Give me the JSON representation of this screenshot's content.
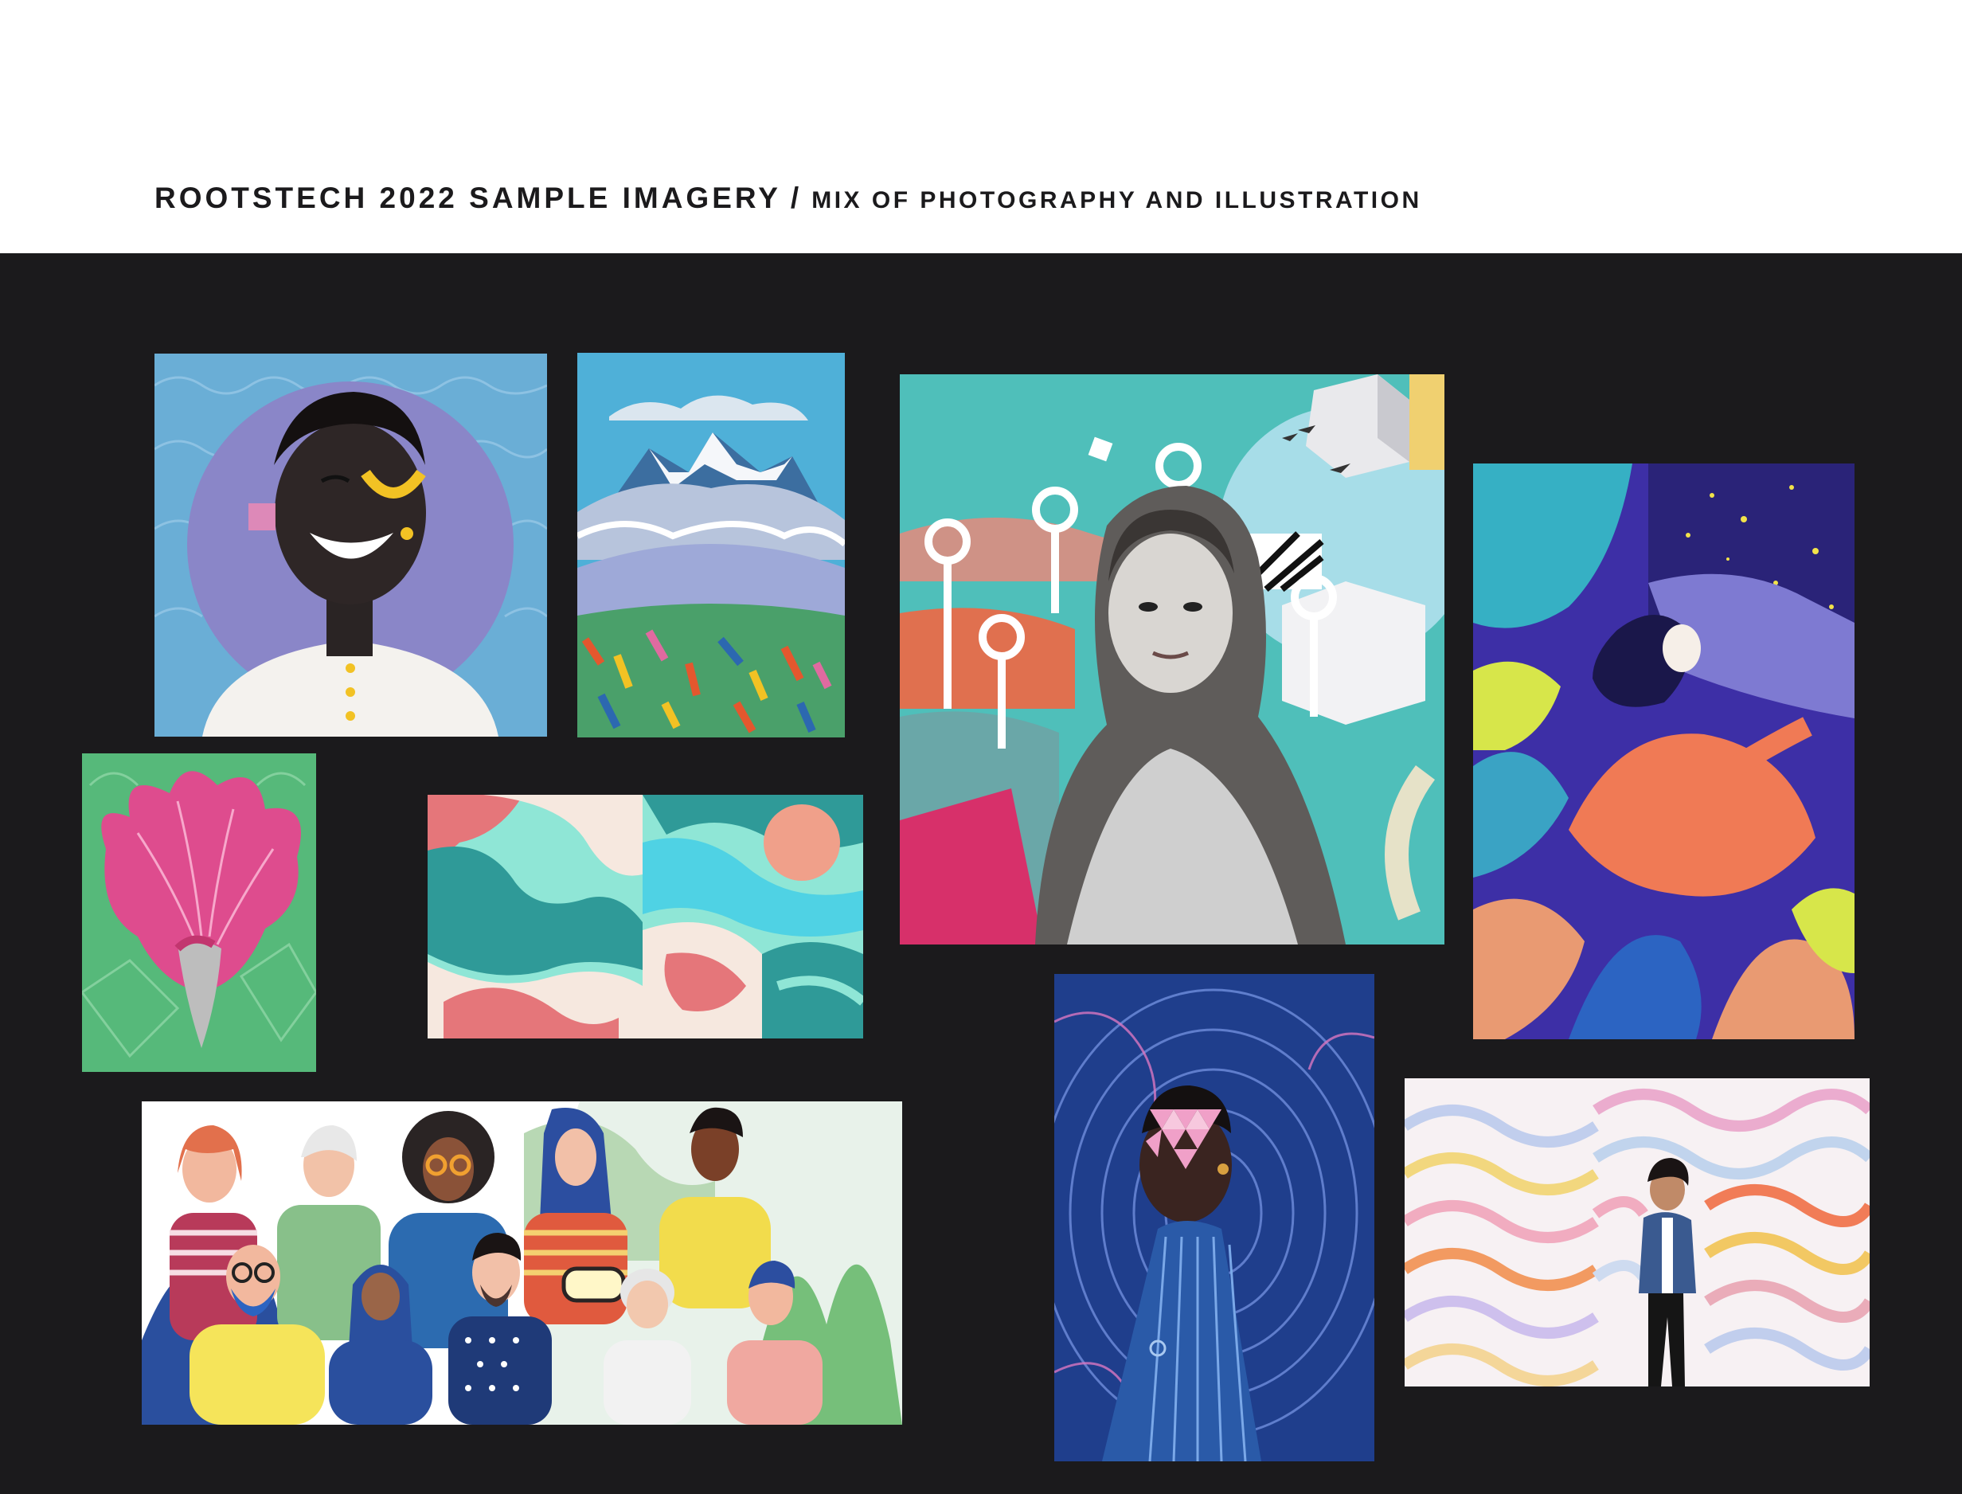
{
  "header": {
    "title_main": "ROOTSTECH 2022 SAMPLE IMAGERY",
    "separator": "/",
    "title_sub": "MIX OF PHOTOGRAPHY AND ILLUSTRATION"
  },
  "colors": {
    "header_bg": "#ffffff",
    "board_bg": "#1b1a1c",
    "title_text": "#1b1a1c"
  },
  "tiles": [
    {
      "name": "smiling-woman-halo-illustration"
    },
    {
      "name": "mountain-landscape-illustration"
    },
    {
      "name": "vintage-portrait-collage"
    },
    {
      "name": "woman-leaves-illustration"
    },
    {
      "name": "pink-hair-illustration"
    },
    {
      "name": "abstract-waves-pattern"
    },
    {
      "name": "diverse-group-illustration"
    },
    {
      "name": "woman-geometric-face-collage"
    },
    {
      "name": "woman-mural-wall-photo"
    }
  ]
}
